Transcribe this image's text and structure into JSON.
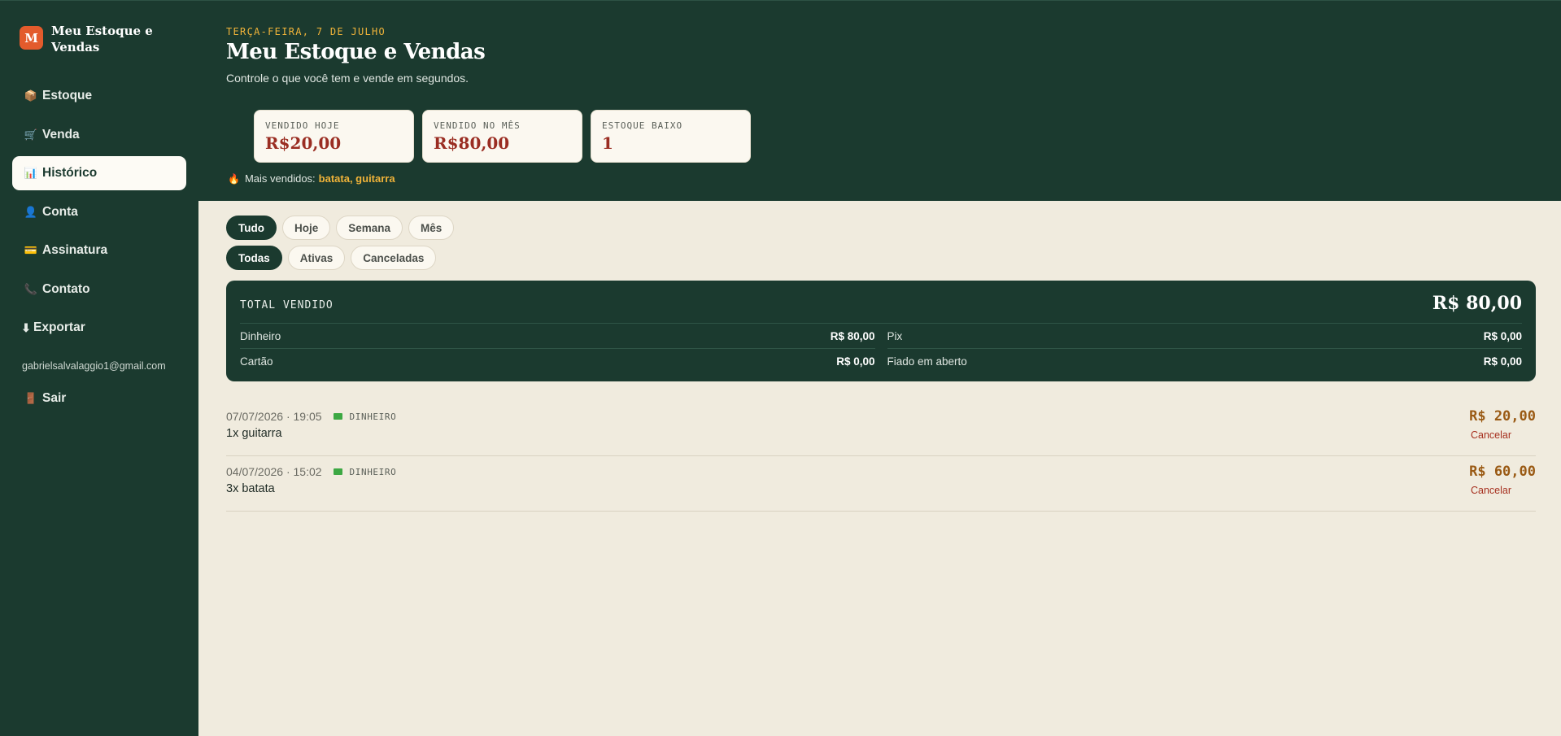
{
  "app": {
    "logo_letter": "M",
    "name": "Meu Estoque e Vendas"
  },
  "sidebar": {
    "items": [
      {
        "icon": "📦",
        "label": "Estoque",
        "active": false
      },
      {
        "icon": "🛒",
        "label": "Venda",
        "active": false
      },
      {
        "icon": "📊",
        "label": "Histórico",
        "active": true
      },
      {
        "icon": "👤",
        "label": "Conta",
        "active": false
      },
      {
        "icon": "💳",
        "label": "Assinatura",
        "active": false
      },
      {
        "icon": "📞",
        "label": "Contato",
        "active": false
      }
    ],
    "export": {
      "icon": "⬇",
      "label": "Exportar"
    },
    "email": "gabrielsalvalaggio1@gmail.com",
    "logout": {
      "icon": "🚪",
      "label": "Sair"
    }
  },
  "header": {
    "date": "TERÇA-FEIRA, 7 DE JULHO",
    "title": "Meu Estoque e Vendas",
    "subtitle": "Controle o que você tem e vende em segundos.",
    "stats": [
      {
        "label": "VENDIDO HOJE",
        "value": "R$20,00"
      },
      {
        "label": "VENDIDO NO MÊS",
        "value": "R$80,00"
      },
      {
        "label": "ESTOQUE BAIXO",
        "value": "1"
      }
    ],
    "bestsellers": {
      "icon": "🔥",
      "label": "Mais vendidos:",
      "items": "batata, guitarra"
    }
  },
  "filters": {
    "period": [
      {
        "label": "Tudo",
        "active": true
      },
      {
        "label": "Hoje",
        "active": false
      },
      {
        "label": "Semana",
        "active": false
      },
      {
        "label": "Mês",
        "active": false
      }
    ],
    "status": [
      {
        "label": "Todas",
        "active": true
      },
      {
        "label": "Ativas",
        "active": false
      },
      {
        "label": "Canceladas",
        "active": false
      }
    ]
  },
  "summary": {
    "label": "TOTAL VENDIDO",
    "total": "R$ 80,00",
    "methods": {
      "dinheiro": {
        "label": "Dinheiro",
        "value": "R$ 80,00"
      },
      "pix": {
        "label": "Pix",
        "value": "R$ 0,00"
      },
      "cartao": {
        "label": "Cartão",
        "value": "R$ 0,00"
      },
      "fiado": {
        "label": "Fiado em aberto",
        "value": "R$ 0,00"
      }
    }
  },
  "sales": [
    {
      "datetime": "07/07/2026 · 19:05",
      "method_icon": "cash-icon",
      "method": "DINHEIRO",
      "items": "1x guitarra",
      "amount": "R$ 20,00",
      "cancel": "Cancelar"
    },
    {
      "datetime": "04/07/2026 · 15:02",
      "method_icon": "cash-icon",
      "method": "DINHEIRO",
      "items": "3x batata",
      "amount": "R$ 60,00",
      "cancel": "Cancelar"
    }
  ]
}
